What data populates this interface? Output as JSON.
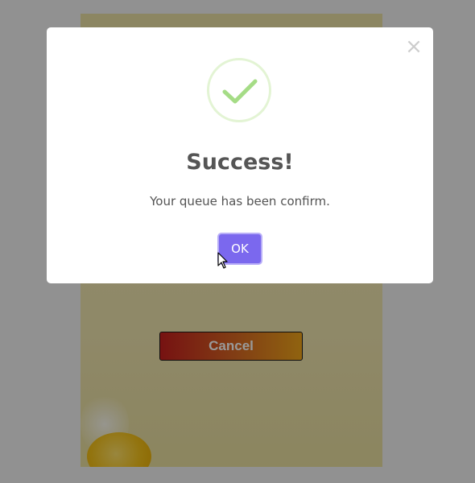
{
  "background": {
    "cancel_label": "Cancel"
  },
  "modal": {
    "close_glyph": "×",
    "icon": "checkmark-icon",
    "title": "Success!",
    "message": "Your queue has been confirm.",
    "ok_label": "OK"
  },
  "colors": {
    "ok_button": "#7b68ee",
    "checkmark": "#a5dc86",
    "overlay": "rgba(0,0,0,0.4)"
  }
}
